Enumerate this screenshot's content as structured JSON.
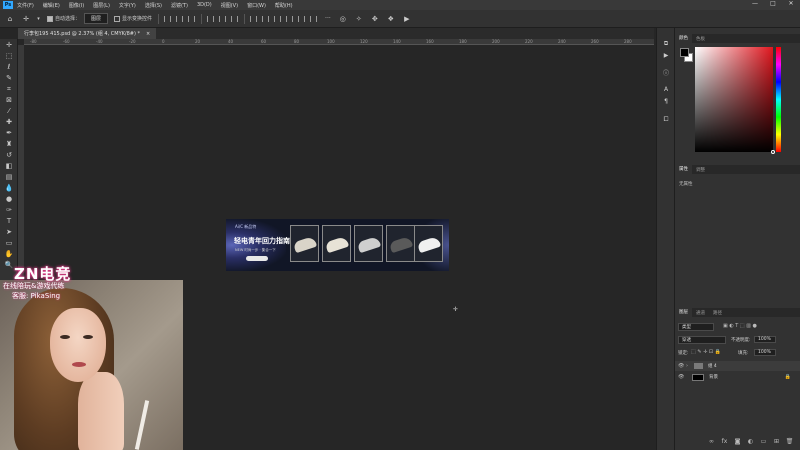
{
  "app": {
    "logo_text": "Ps",
    "menu": [
      "文件(F)",
      "编辑(E)",
      "图像(I)",
      "图层(L)",
      "文字(Y)",
      "选择(S)",
      "滤镜(T)",
      "3D(D)",
      "视图(V)",
      "窗口(W)",
      "帮助(H)"
    ],
    "window_controls": [
      "—",
      "□",
      "✕"
    ]
  },
  "options_bar": {
    "auto_select_label": "自动选择：",
    "auto_select_value": "图层",
    "show_transform_label": "显示变换控件",
    "more": "···"
  },
  "document": {
    "tab_title": "行李包195 415.psd @ 2.37% (组 4, CMYK/8#) *",
    "close": "×",
    "ruler_ticks": [
      "-80",
      "-60",
      "-40",
      "-20",
      "0",
      "20",
      "40",
      "60",
      "80",
      "100",
      "120",
      "140",
      "160",
      "180",
      "200",
      "220",
      "240",
      "260",
      "280"
    ]
  },
  "banner": {
    "brand": "Ai/C 新品特",
    "headline": "轻电青年回力指南",
    "sub": "NEW 时尚一步 · 集合一下",
    "cards": [
      {
        "shoe_color": "#d9d4c8"
      },
      {
        "shoe_color": "#e7e2d6"
      },
      {
        "shoe_color": "#cfcfcf"
      },
      {
        "shoe_color": "#5a5a5a"
      },
      {
        "shoe_color": "#f0f0f0"
      }
    ]
  },
  "color_panel": {
    "tabs": [
      "颜色",
      "色板"
    ],
    "colors": {
      "foreground": "#000000",
      "background": "#ffffff",
      "hue": "#e0161e"
    }
  },
  "properties_panel": {
    "tabs": [
      "属性",
      "调整"
    ],
    "label": "无属性"
  },
  "layers_panel": {
    "tabs": [
      "图层",
      "通道",
      "路径"
    ],
    "filter_kind": "类型",
    "blend_mode": "穿透",
    "opacity_label": "不透明度:",
    "opacity_value": "100%",
    "lock_label": "锁定:",
    "fill_label": "填充:",
    "fill_value": "100%",
    "layers": [
      {
        "name": "组 4",
        "type": "group"
      },
      {
        "name": "背景",
        "type": "background"
      }
    ],
    "bottom_icons": [
      "link-icon",
      "fx-icon",
      "mask-icon",
      "adjustment-icon",
      "folder-icon",
      "new-layer-icon",
      "trash-icon"
    ]
  },
  "overlay": {
    "title": "ZN电竞",
    "line1": "在线陪玩&游戏代练",
    "line2": "客服: PikaSing"
  }
}
